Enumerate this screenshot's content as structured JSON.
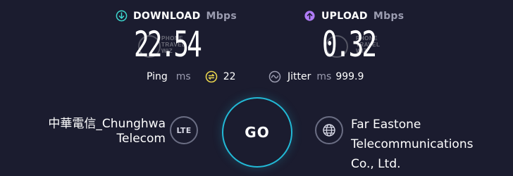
{
  "download": {
    "label": "DOWNLOAD",
    "unit": "Mbps",
    "value": "22.54",
    "icon": "download-arrow-icon",
    "icon_color": "#3dd8cf"
  },
  "upload": {
    "label": "UPLOAD",
    "unit": "Mbps",
    "value": "0.32",
    "icon": "upload-arrow-icon",
    "icon_color": "#b07cf7"
  },
  "watermark": {
    "line1": "PHONE",
    "line2": "TRAVEL",
    "line3": "WIZ"
  },
  "ping": {
    "label": "Ping",
    "unit": "ms",
    "value": "22",
    "icon_color": "#e8d44d"
  },
  "jitter": {
    "label": "Jitter",
    "unit": "ms",
    "value": "999.9"
  },
  "isp": {
    "line1": "中華電信_Chunghwa",
    "line2": "Telecom",
    "badge": "LTE"
  },
  "go_button": {
    "label": "GO",
    "accent": "#22b9d6"
  },
  "server": {
    "line1": "Far Eastone",
    "line2": "Telecommunications",
    "line3": "Co., Ltd."
  }
}
